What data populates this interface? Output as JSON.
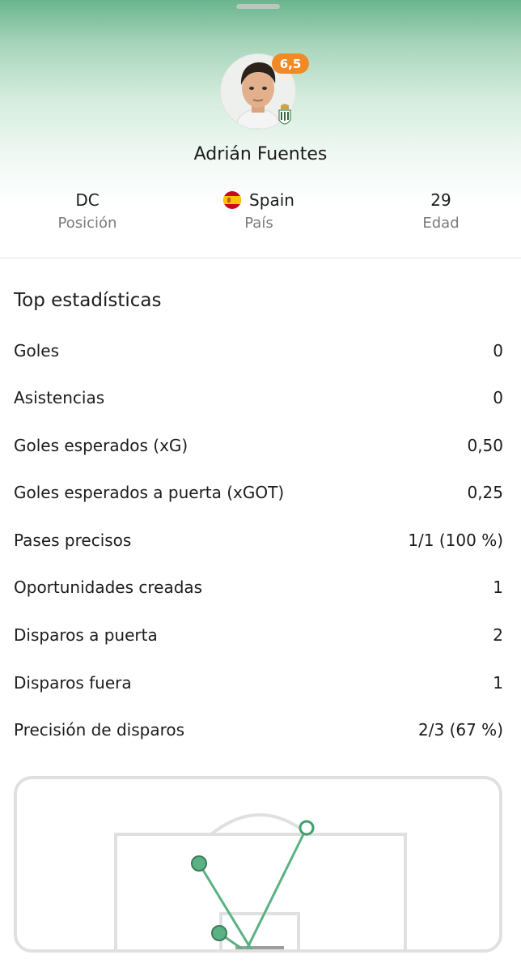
{
  "player": {
    "name": "Adrián Fuentes",
    "rating": "6,5"
  },
  "info": {
    "position": {
      "value": "DC",
      "label": "Posición"
    },
    "country": {
      "value": "Spain",
      "label": "País"
    },
    "age": {
      "value": "29",
      "label": "Edad"
    }
  },
  "stats": {
    "title": "Top estadísticas",
    "rows": [
      {
        "label": "Goles",
        "value": "0"
      },
      {
        "label": "Asistencias",
        "value": "0"
      },
      {
        "label": "Goles esperados (xG)",
        "value": "0,50"
      },
      {
        "label": "Goles esperados a puerta (xGOT)",
        "value": "0,25"
      },
      {
        "label": "Pases precisos",
        "value": "1/1 (100 %)"
      },
      {
        "label": "Oportunidades creadas",
        "value": "1"
      },
      {
        "label": "Disparos a puerta",
        "value": "2"
      },
      {
        "label": "Disparos fuera",
        "value": "1"
      },
      {
        "label": "Precisión de disparos",
        "value": "2/3 (67 %)"
      }
    ]
  },
  "colors": {
    "rating_badge": "#f08a27",
    "accent_green": "#3fa16e",
    "shot_on_target": "#5ab184",
    "shot_off_target": "#ffffff"
  },
  "icons": {
    "flag": "spain-flag-icon",
    "club": "club-crest-icon"
  }
}
